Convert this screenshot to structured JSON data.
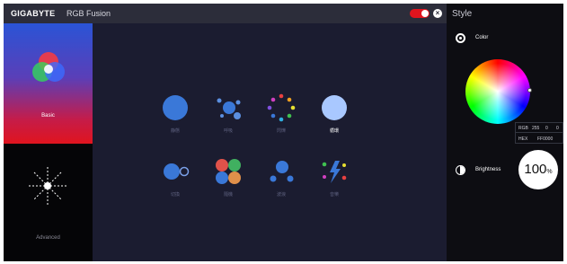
{
  "titlebar": {
    "brand": "GIGABYTE",
    "title": "RGB Fusion",
    "power_on": true,
    "close_icon": "×"
  },
  "modes": [
    {
      "label": "Basic",
      "icon": "rgb-circles-icon",
      "active": true
    },
    {
      "label": "Advanced",
      "icon": "starburst-icon",
      "active": false
    }
  ],
  "effects": [
    {
      "label": "静態",
      "icon": "static-icon",
      "active": false
    },
    {
      "label": "呼吸",
      "icon": "pulse-icon",
      "active": false
    },
    {
      "label": "閃爍",
      "icon": "flash-icon",
      "active": false
    },
    {
      "label": "循環",
      "icon": "cycle-icon",
      "active": true
    },
    {
      "label": "切換",
      "icon": "switch-icon",
      "active": false
    },
    {
      "label": "隨機",
      "icon": "random-icon",
      "active": false
    },
    {
      "label": "波浪",
      "icon": "wave-icon",
      "active": false
    },
    {
      "label": "音樂",
      "icon": "music-icon",
      "active": false
    }
  ],
  "style": {
    "title": "Style",
    "color_label": "Color",
    "rgb_label": "RGB",
    "rgb_values": [
      "255",
      "0",
      "0"
    ],
    "hex_label": "HEX",
    "hex_value": "FF0000",
    "brightness_label": "Brightness",
    "brightness_value": "100",
    "brightness_unit": "%"
  },
  "colors": {
    "accent_red": "#e0141e",
    "background": "#1b1c30",
    "effect_blue": "#3a78d8"
  }
}
